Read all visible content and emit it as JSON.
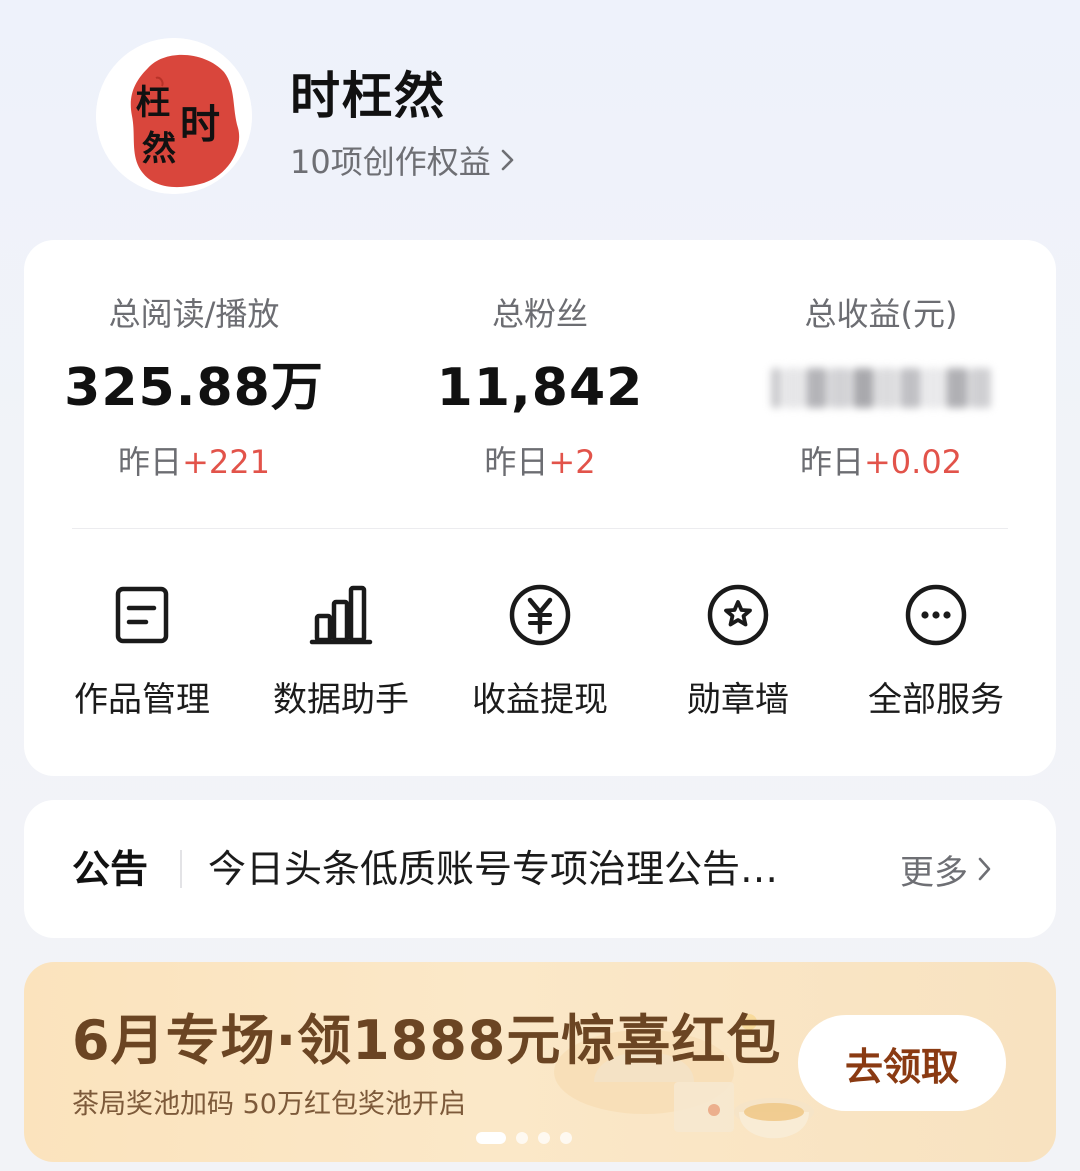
{
  "profile": {
    "name": "时枉然",
    "avatar_text": "枉然时",
    "benefits_label": "10项创作权益",
    "chevron_icon": "chevron-right-icon"
  },
  "stats": [
    {
      "label": "总阅读/播放",
      "value": "325.88万",
      "delta_prefix": "昨日",
      "delta": "+221",
      "hidden": false
    },
    {
      "label": "总粉丝",
      "value": "11,842",
      "delta_prefix": "昨日",
      "delta": "+2",
      "hidden": false
    },
    {
      "label": "总收益(元)",
      "value": "",
      "delta_prefix": "昨日",
      "delta": "+0.02",
      "hidden": true
    }
  ],
  "services": [
    {
      "label": "作品管理",
      "icon": "document-icon"
    },
    {
      "label": "数据助手",
      "icon": "bar-chart-icon"
    },
    {
      "label": "收益提现",
      "icon": "yuan-coin-icon"
    },
    {
      "label": "勋章墙",
      "icon": "medal-star-icon"
    },
    {
      "label": "全部服务",
      "icon": "more-dots-icon"
    }
  ],
  "notice": {
    "tag": "公告",
    "text": "今日头条低质账号专项治理公告…",
    "more_label": "更多"
  },
  "banner": {
    "title": "6月专场·领1888元惊喜红包",
    "subtitle": "茶局奖池加码 50万红包奖池开启",
    "cta": "去领取",
    "page_count": 4,
    "active_page": 1
  },
  "colors": {
    "delta_red": "#e2534a",
    "banner_bg": "#fbe3bd",
    "banner_title": "#6b4523",
    "cta_text": "#8a3a12",
    "avatar_red": "#d9463c"
  }
}
